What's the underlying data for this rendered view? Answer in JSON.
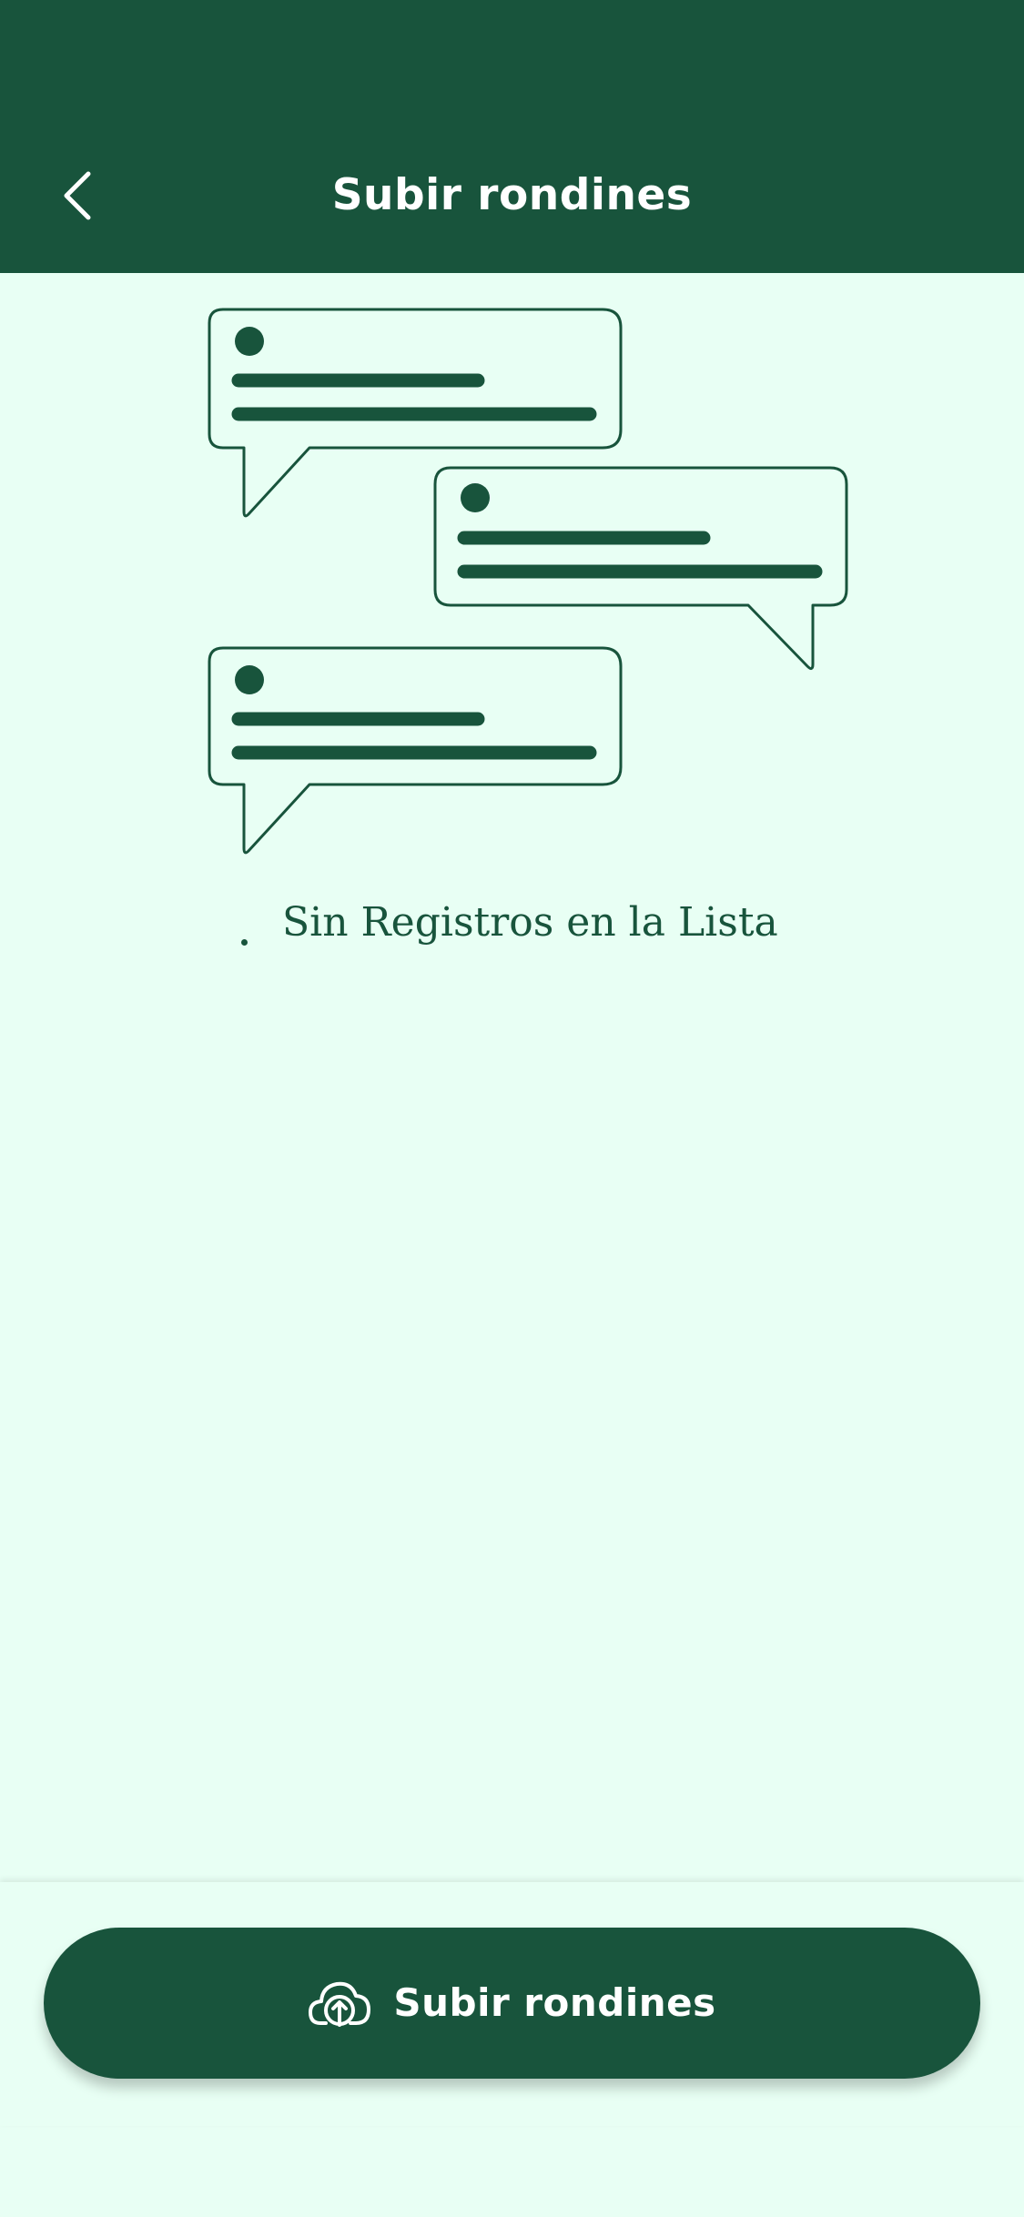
{
  "header": {
    "title": "Subir rondines",
    "back_icon": "chevron-left-icon"
  },
  "empty_state": {
    "illustration_icon": "chat-bubbles-illustration",
    "message": "Sin Registros en la Lista"
  },
  "footer": {
    "upload_button_label": "Subir rondines",
    "upload_icon": "cloud-upload-icon"
  },
  "colors": {
    "primary": "#18543C",
    "background": "#E8FFF4",
    "on_primary": "#FFFFFF"
  }
}
